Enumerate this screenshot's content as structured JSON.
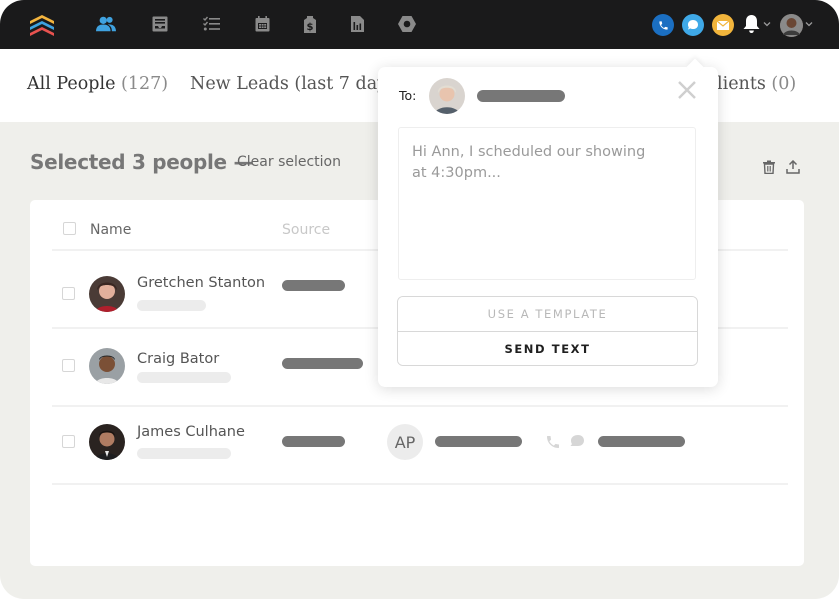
{
  "nav": {
    "logo": "stacked-chevrons-logo",
    "items": [
      {
        "name": "people",
        "icon": "people-icon",
        "active": true
      },
      {
        "name": "inbox",
        "icon": "inbox-icon",
        "active": false
      },
      {
        "name": "tasks",
        "icon": "tasks-icon",
        "active": false
      },
      {
        "name": "calendar",
        "icon": "calendar-icon",
        "active": false
      },
      {
        "name": "deals",
        "icon": "price-tag-icon",
        "active": false
      },
      {
        "name": "reporting",
        "icon": "report-icon",
        "active": false
      },
      {
        "name": "admin",
        "icon": "hexagon-icon",
        "active": false
      }
    ],
    "right": {
      "call": "phone-icon",
      "text": "chat-bubble-icon",
      "email": "envelope-icon",
      "notifications": "bell-icon",
      "account": "user-avatar"
    },
    "colors": {
      "bar": "#1a1a1b",
      "active": "#3fa2e0",
      "inactive": "#8a8a8a",
      "call": "#1b6fc2",
      "text": "#3fa9e8",
      "email": "#f2b53c",
      "logo_top": "#f3b43e",
      "logo_mid": "#3fa2e0",
      "logo_bot": "#e8524f"
    }
  },
  "tabs": [
    {
      "label": "All People",
      "count": "(127)"
    },
    {
      "label": "New Leads (last 7 day",
      "count": ""
    },
    {
      "label": "lients",
      "count": "(0)"
    }
  ],
  "selection": {
    "title": "Selected 3 people —",
    "clear": "Clear selection",
    "actions": [
      "trash-icon",
      "export-icon"
    ]
  },
  "table": {
    "columns": [
      "Name",
      "Source"
    ],
    "rows": [
      {
        "name": "Gretchen Stanton"
      },
      {
        "name": "Craig Bator"
      },
      {
        "name": "James Culhane",
        "agent_initials": "AP"
      }
    ]
  },
  "popover": {
    "to_label": "To:",
    "message": "Hi Ann, I scheduled our showing\nat 4:30pm...",
    "template_button": "USE A TEMPLATE",
    "send_button": "SEND TEXT"
  }
}
